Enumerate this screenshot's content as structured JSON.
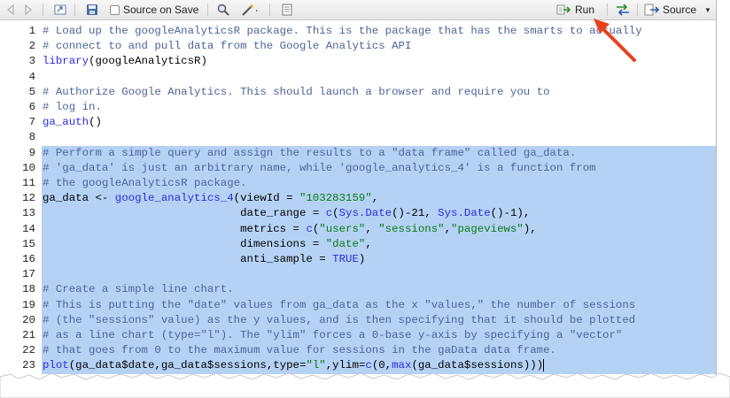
{
  "toolbar": {
    "source_on_save_label": "Source on Save",
    "run_label": "Run",
    "source_label": "Source"
  },
  "colors": {
    "selection": "#b5d2f5",
    "comment": "#4d6396",
    "keyword": "#2a2ae0",
    "string": "#0b7a13",
    "annotation_arrow": "#e8421b"
  },
  "editor": {
    "lines": [
      {
        "num": "1",
        "text": "# Load up the googleAnalyticsR package. This is the package that has the smarts to actually"
      },
      {
        "num": "2",
        "text": "# connect to and pull data from the Google Analytics API"
      },
      {
        "num": "3",
        "text": "library(googleAnalyticsR)"
      },
      {
        "num": "4",
        "text": ""
      },
      {
        "num": "5",
        "text": "# Authorize Google Analytics. This should launch a browser and require you to"
      },
      {
        "num": "6",
        "text": "# log in."
      },
      {
        "num": "7",
        "text": "ga_auth()"
      },
      {
        "num": "8",
        "text": ""
      },
      {
        "num": "9",
        "text": "# Perform a simple query and assign the results to a \"data frame\" called ga_data."
      },
      {
        "num": "10",
        "text": "# 'ga_data' is just an arbitrary name, while 'google_analytics_4' is a function from"
      },
      {
        "num": "11",
        "text": "# the googleAnalyticsR package."
      },
      {
        "num": "12",
        "text": "ga_data <- google_analytics_4(viewId = \"103283159\","
      },
      {
        "num": "13",
        "text": "                              date_range = c(Sys.Date()-21, Sys.Date()-1),"
      },
      {
        "num": "14",
        "text": "                              metrics = c(\"users\", \"sessions\",\"pageviews\"),"
      },
      {
        "num": "15",
        "text": "                              dimensions = \"date\","
      },
      {
        "num": "16",
        "text": "                              anti_sample = TRUE)"
      },
      {
        "num": "17",
        "text": ""
      },
      {
        "num": "18",
        "text": "# Create a simple line chart."
      },
      {
        "num": "19",
        "text": "# This is putting the \"date\" values from ga_data as the x \"values,\" the number of sessions"
      },
      {
        "num": "20",
        "text": "# (the \"sessions\" value) as the y values, and is then specifying that it should be plotted"
      },
      {
        "num": "21",
        "text": "# as a line chart (type=\"l\"). The \"ylim\" forces a 0-base y-axis by specifying a \"vector\""
      },
      {
        "num": "22",
        "text": "# that goes from 0 to the maximum value for sessions in the gaData data frame."
      },
      {
        "num": "23",
        "text": "plot(ga_data$date,ga_data$sessions,type=\"l\",ylim=c(0,max(ga_data$sessions)))"
      }
    ]
  }
}
